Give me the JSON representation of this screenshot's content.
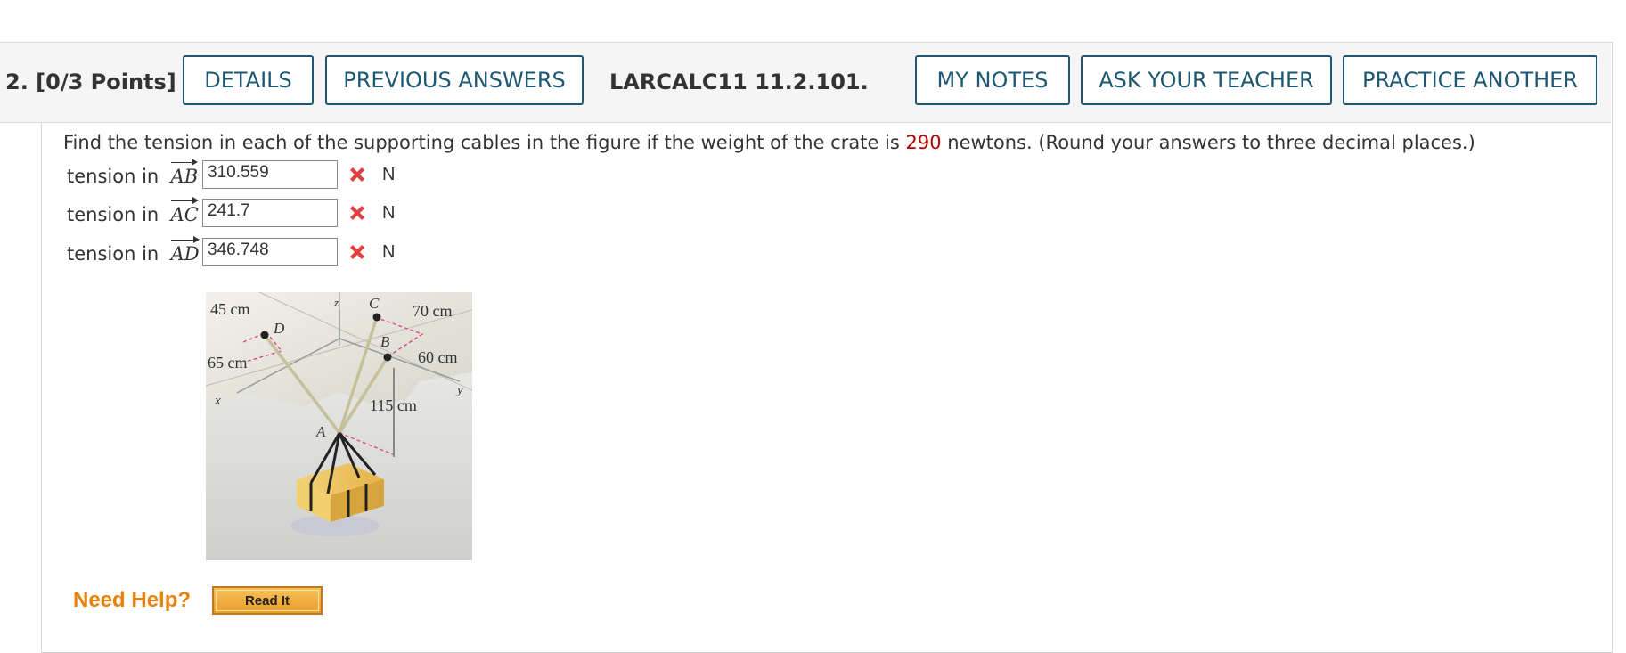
{
  "question": {
    "number_points": "2.  [0/3 Points]",
    "code": "LARCALC11 11.2.101."
  },
  "buttons": {
    "details": "DETAILS",
    "previous_answers": "PREVIOUS ANSWERS",
    "my_notes": "MY NOTES",
    "ask_teacher": "ASK YOUR TEACHER",
    "practice_another": "PRACTICE ANOTHER"
  },
  "prompt": {
    "before": "Find the tension in each of the supporting cables in the figure if the weight of the crate is ",
    "value": "290",
    "after": " newtons. (Round your answers to three decimal places.)",
    "highlight_color": "#b30000"
  },
  "answers": [
    {
      "label": "tension in",
      "vector": "AB",
      "value": "310.559",
      "unit": "N",
      "status": "incorrect"
    },
    {
      "label": "tension in",
      "vector": "AC",
      "value": "241.7",
      "unit": "N",
      "status": "incorrect"
    },
    {
      "label": "tension in",
      "vector": "AD",
      "value": "346.748",
      "unit": "N",
      "status": "incorrect"
    }
  ],
  "figure": {
    "labels": {
      "d45": "45 cm",
      "d70": "70 cm",
      "d65": "65 cm",
      "d60": "60 cm",
      "d115": "115 cm",
      "z": "z",
      "x": "x",
      "y": "y",
      "A": "A",
      "B": "B",
      "C": "C",
      "D": "D"
    }
  },
  "help": {
    "need_help": "Need Help?",
    "read_it": "Read It"
  },
  "colors": {
    "button_border": "#1d5770",
    "need_help": "#e8820c",
    "error_x": "#e04040"
  }
}
